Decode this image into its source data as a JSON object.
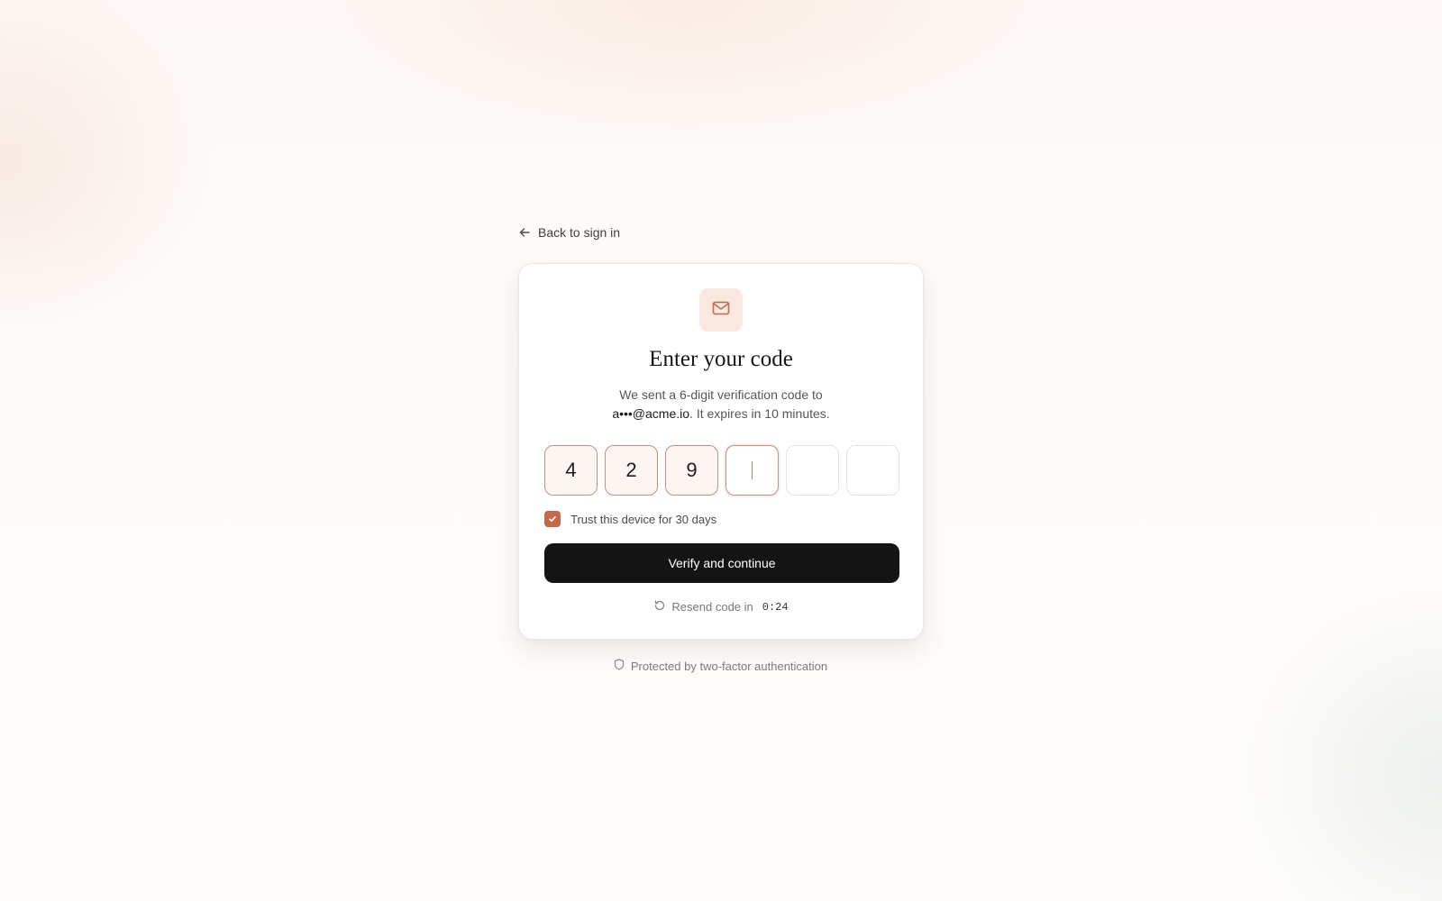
{
  "back_link": {
    "label": "Back to sign in",
    "icon": "arrow-left-icon"
  },
  "card": {
    "icon": "mail-icon",
    "title": "Enter your code",
    "description_line1": "We sent a 6-digit verification code to",
    "email": "a•••@acme.io",
    "description_line2": ". It expires in 10 minutes.",
    "otp": {
      "digits": [
        "4",
        "2",
        "9",
        "",
        "",
        ""
      ],
      "active_index": 3
    },
    "trust_device": {
      "label": "Trust this device for 30 days",
      "checked": true
    },
    "verify_button": {
      "label": "Verify and continue"
    },
    "resend": {
      "label": "Resend code in",
      "timer": "0:24",
      "icon": "refresh-icon"
    }
  },
  "footer": {
    "label": "Protected by two-factor authentication",
    "icon": "shield-icon"
  },
  "colors": {
    "accent": "#c4694b",
    "accent_soft": "#f9e7e0",
    "button_bg": "#141414",
    "button_text": "#ffffff"
  }
}
